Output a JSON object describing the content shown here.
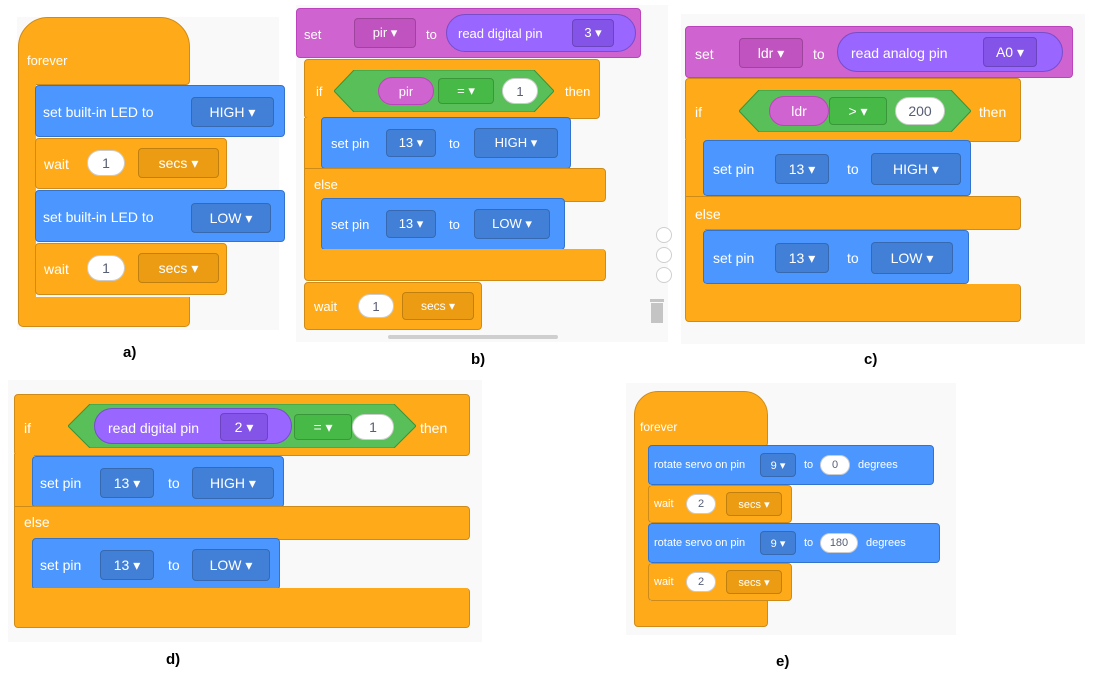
{
  "captions": {
    "a": "a)",
    "b": "b)",
    "c": "c)",
    "d": "d)",
    "e": "e)"
  },
  "colors": {
    "control": "#ffab19",
    "arduino": "#4c97ff",
    "variables": "#cf63cf",
    "operators": "#59c059",
    "reporter": "#9966ff"
  },
  "icons": {
    "dropdown_arrow": "caret-down-icon",
    "trash": "trash-icon",
    "zoom": "zoom-buttons"
  },
  "a": {
    "forever": "forever",
    "set_led_1": {
      "label": "set built-in LED to",
      "value": "HIGH ▾"
    },
    "wait_1": {
      "label": "wait",
      "value": "1",
      "unit": "secs ▾"
    },
    "set_led_2": {
      "label": "set built-in LED to",
      "value": "LOW ▾"
    },
    "wait_2": {
      "label": "wait",
      "value": "1",
      "unit": "secs ▾"
    }
  },
  "b": {
    "set": {
      "label": "set",
      "var": "pir ▾",
      "to": "to",
      "reporter": "read digital pin",
      "pin": "3 ▾"
    },
    "if": {
      "label": "if",
      "var": "pir",
      "op": "= ▾",
      "value": "1",
      "then": "then"
    },
    "set_pin_high": {
      "label": "set pin",
      "pin": "13 ▾",
      "to": "to",
      "value": "HIGH ▾"
    },
    "else": "else",
    "set_pin_low": {
      "label": "set pin",
      "pin": "13 ▾",
      "to": "to",
      "value": "LOW ▾"
    },
    "wait": {
      "label": "wait",
      "value": "1",
      "unit": "secs ▾"
    }
  },
  "c": {
    "set": {
      "label": "set",
      "var": "ldr ▾",
      "to": "to",
      "reporter": "read analog pin",
      "pin": "A0 ▾"
    },
    "if": {
      "label": "if",
      "var": "ldr",
      "op": "> ▾",
      "value": "200",
      "then": "then"
    },
    "set_pin_high": {
      "label": "set pin",
      "pin": "13 ▾",
      "to": "to",
      "value": "HIGH ▾"
    },
    "else": "else",
    "set_pin_low": {
      "label": "set pin",
      "pin": "13 ▾",
      "to": "to",
      "value": "LOW ▾"
    }
  },
  "d": {
    "if": {
      "label": "if",
      "reporter": "read digital pin",
      "pin": "2 ▾",
      "op": "= ▾",
      "value": "1",
      "then": "then"
    },
    "set_pin_high": {
      "label": "set pin",
      "pin": "13 ▾",
      "to": "to",
      "value": "HIGH ▾"
    },
    "else": "else",
    "set_pin_low": {
      "label": "set pin",
      "pin": "13 ▾",
      "to": "to",
      "value": "LOW ▾"
    }
  },
  "e": {
    "forever": "forever",
    "rotate_1": {
      "label": "rotate servo on pin",
      "pin": "9 ▾",
      "to": "to",
      "value": "0",
      "unit": "degrees"
    },
    "wait_1": {
      "label": "wait",
      "value": "2",
      "unit": "secs ▾"
    },
    "rotate_2": {
      "label": "rotate servo on pin",
      "pin": "9 ▾",
      "to": "to",
      "value": "180",
      "unit": "degrees"
    },
    "wait_2": {
      "label": "wait",
      "value": "2",
      "unit": "secs ▾"
    }
  }
}
